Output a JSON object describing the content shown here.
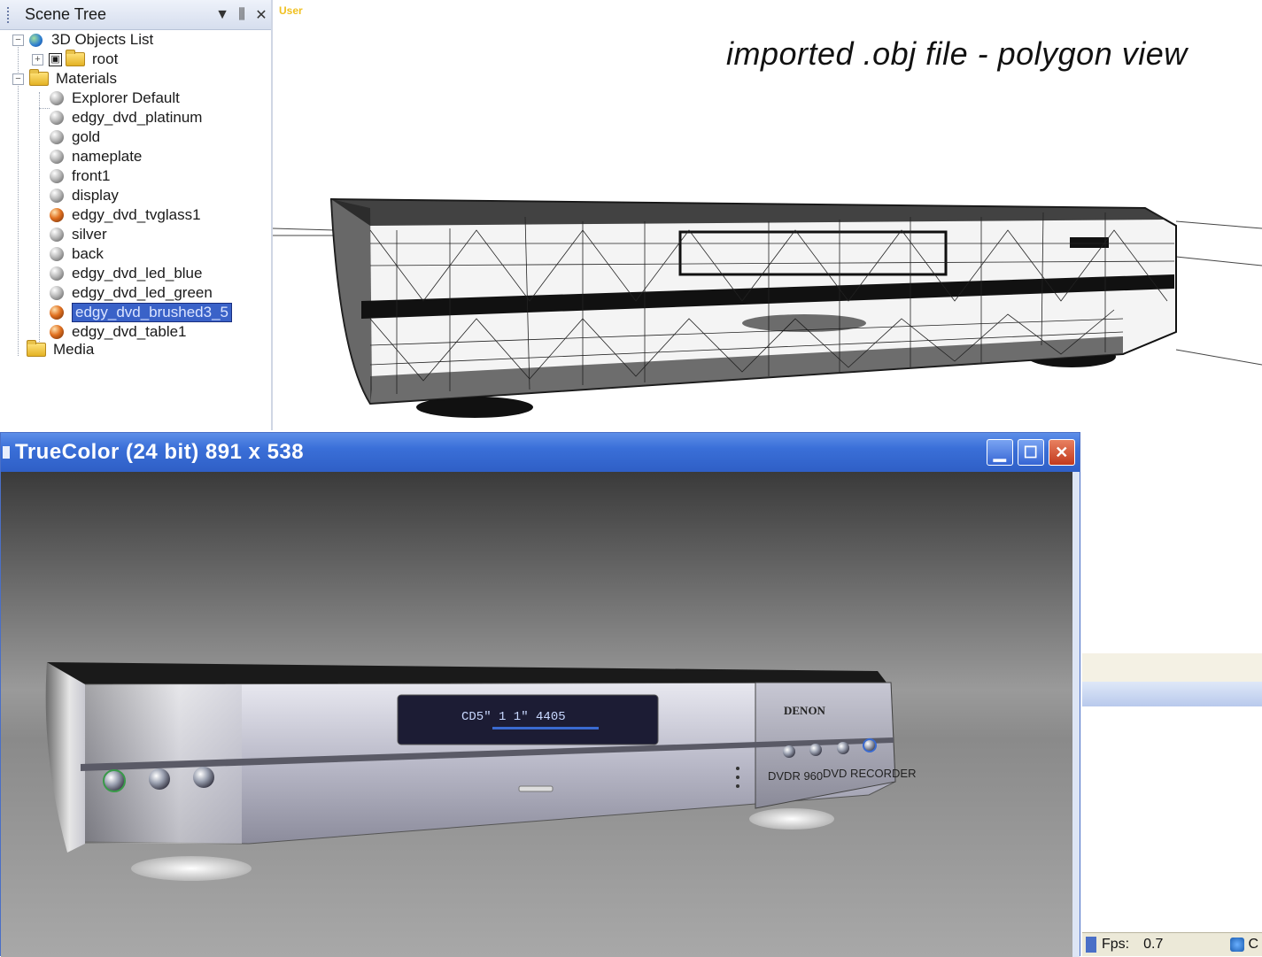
{
  "scene_tree": {
    "title": "Scene Tree",
    "controls": {
      "dropdown": "▼",
      "pin": "⫼",
      "close": "✕"
    },
    "objects_list_label": "3D Objects List",
    "root_label": "root",
    "materials_label": "Materials",
    "materials": [
      {
        "label": "Explorer Default",
        "icon": "grey-sphere-icon"
      },
      {
        "label": "edgy_dvd_platinum",
        "icon": "grey-sphere-icon"
      },
      {
        "label": "gold",
        "icon": "grey-sphere-icon"
      },
      {
        "label": "nameplate",
        "icon": "grey-sphere-icon"
      },
      {
        "label": "front1",
        "icon": "grey-sphere-icon"
      },
      {
        "label": "display",
        "icon": "grey-sphere-icon"
      },
      {
        "label": "edgy_dvd_tvglass1",
        "icon": "orange-sphere-icon"
      },
      {
        "label": "silver",
        "icon": "grey-sphere-icon"
      },
      {
        "label": "back",
        "icon": "grey-sphere-icon"
      },
      {
        "label": "edgy_dvd_led_blue",
        "icon": "grey-sphere-icon"
      },
      {
        "label": "edgy_dvd_led_green",
        "icon": "grey-sphere-icon"
      },
      {
        "label": "edgy_dvd_brushed3_5",
        "icon": "orange-sphere-icon",
        "selected": true
      },
      {
        "label": "edgy_dvd_table1",
        "icon": "orange-sphere-icon"
      }
    ],
    "media_label": "Media"
  },
  "viewport": {
    "view_label": "User",
    "caption": "imported .obj file - polygon view"
  },
  "render_window": {
    "title": "TrueColor (24 bit) 891 x 538",
    "minimize": "▁",
    "maximize": "☐",
    "close": "✕",
    "device": {
      "brand": "DENON",
      "model": "DVDR 960",
      "type": "DVD RECORDER",
      "display_text": "CD5\" 1 1\"   4405"
    }
  },
  "status_bar": {
    "fps_label": "Fps:",
    "fps_value": "0.7",
    "trailing": "C"
  },
  "colors": {
    "title_bar": "#3a6fd8",
    "selection": "#3a62c8",
    "view_label": "#f0c020"
  }
}
